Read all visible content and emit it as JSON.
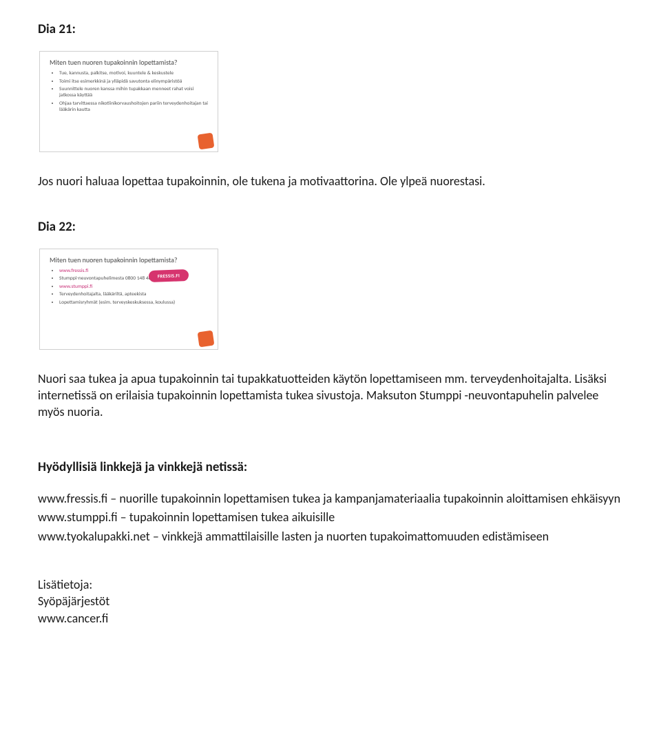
{
  "dia21": {
    "label": "Dia 21:",
    "slide": {
      "title": "Miten tuen nuoren tupakoinnin lopettamista?",
      "bullets": [
        "Tue, kannusta, palkitse, motivoi, kuuntele & keskustele",
        "Toimi itse esimerkkinä ja ylläpidä savutonta elinympäristöä",
        "Suunnittele nuoren kanssa mihin tupakkaan menneet rahat voisi jatkossa käyttää",
        "Ohjaa tarvittaessa nikotiinikorvaushoitojen pariin terveydenhoitajan tai lääkärin kautta"
      ]
    },
    "body": "Jos nuori haluaa lopettaa tupakoinnin, ole tukena ja motivaattorina. Ole ylpeä nuorestasi."
  },
  "dia22": {
    "label": "Dia 22:",
    "slide": {
      "title": "Miten tuen nuoren tupakoinnin lopettamista?",
      "bullets": [
        {
          "text": "www.fressis.fi",
          "pink": true
        },
        {
          "text": "Stumppi-neuvontapuhelimesta 0800 148 484 (maksuton)",
          "pink": false
        },
        {
          "text": "www.stumppi.fi",
          "pink": true
        },
        {
          "text": "Terveydenhoitajalta, lääkäriltä, apteekista",
          "pink": false
        },
        {
          "text": "Lopettamisryhmät (esim. terveyskeskuksessa, koulussa)",
          "pink": false
        }
      ],
      "badge": "FRESSIS.FI"
    },
    "body": "Nuori saa tukea ja apua tupakoinnin tai tupakkatuotteiden käytön lopettamiseen mm. terveydenhoitajalta. Lisäksi internetissä on erilaisia tupakoinnin lopettamista tukea sivustoja. Maksuton Stumppi -neuvontapuhelin palvelee myös nuoria."
  },
  "links": {
    "heading": "Hyödyllisiä linkkejä ja vinkkejä netissä:",
    "items": [
      "www.fressis.fi – nuorille tupakoinnin lopettamisen tukea ja kampanjamateriaalia tupakoinnin aloittamisen ehkäisyyn",
      "www.stumppi.fi – tupakoinnin lopettamisen tukea aikuisille",
      "www.tyokalupakki.net – vinkkejä ammattilaisille lasten ja nuorten tupakoimattomuuden edistämiseen"
    ]
  },
  "footer": {
    "label": "Lisätietoja:",
    "org": "Syöpäjärjestöt",
    "url": "www.cancer.fi"
  }
}
